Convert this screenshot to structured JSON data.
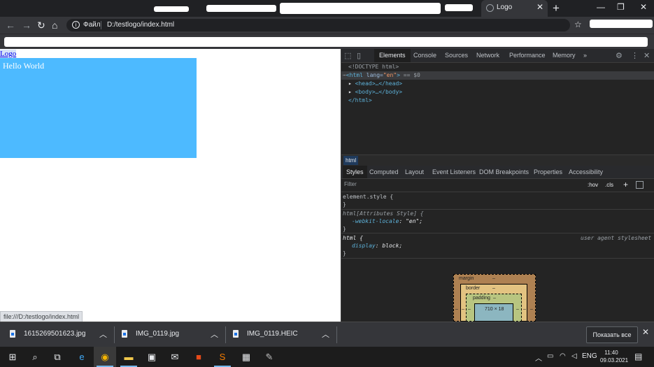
{
  "browser": {
    "active_tab": {
      "title": "Logo"
    },
    "address": {
      "scheme_label": "Файл",
      "url": "D:/testlogo/index.html"
    }
  },
  "page": {
    "link_text": "Logo",
    "box_text": "Hello World",
    "box_color": "#4dbaff",
    "status_url": "file:///D:/testlogo/index.html"
  },
  "devtools": {
    "tabs": [
      "Elements",
      "Console",
      "Sources",
      "Network",
      "Performance",
      "Memory"
    ],
    "more_tabs": "»",
    "dom": {
      "doctype": "<!DOCTYPE html>",
      "html_open_tag": "<html",
      "html_attr_name": "lang",
      "html_attr_value": "\"en\"",
      "html_open_close": ">",
      "selected_marker": "== $0",
      "head": "<head>…</head>",
      "body": "<body>…</body>",
      "html_close": "</html>"
    },
    "breadcrumb": "html",
    "subtabs": [
      "Styles",
      "Computed",
      "Layout",
      "Event Listeners",
      "DOM Breakpoints",
      "Properties",
      "Accessibility"
    ],
    "filter_placeholder": "Filter",
    "hov": ":hov",
    "cls": ".cls",
    "rules": {
      "r1_selector": "element.style {",
      "r1_close": "}",
      "r2_selector": "html[Attributes Style] {",
      "r2_prop": "-webkit-locale",
      "r2_value": "\"en\";",
      "r2_close": "}",
      "r3_selector": "html {",
      "r3_source": "user agent stylesheet",
      "r3_prop": "display",
      "r3_value": "block;",
      "r3_close": "}"
    },
    "box_model": {
      "margin_label": "margin",
      "margin_value": "–",
      "border_label": "border",
      "border_value": "–",
      "padding_label": "padding",
      "padding_value": "–",
      "content_size": "710 × 18",
      "side_value": "–"
    }
  },
  "downloads": {
    "items": [
      "1615269501623.jpg",
      "IMG_0119.jpg",
      "IMG_0119.HEIC"
    ],
    "show_all": "Показать все"
  },
  "taskbar": {
    "lang": "ENG",
    "time": "11:40",
    "date": "09.03.2021"
  }
}
